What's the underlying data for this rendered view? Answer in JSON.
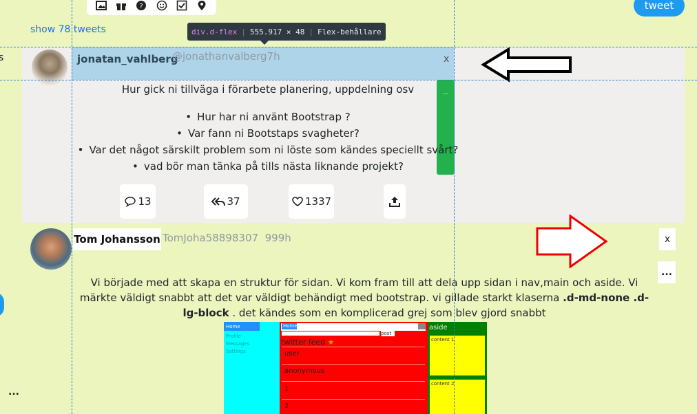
{
  "toolbar": {
    "icons": [
      "image-icon",
      "gift-icon",
      "question-icon",
      "smiley-icon",
      "checkbox-icon",
      "location-pin-icon"
    ],
    "tweet_button": "tweet"
  },
  "feed": {
    "show_tweets_link": "show 78 tweets"
  },
  "devtools_tooltip": {
    "selector": "div.d-flex",
    "size": "555.917 × 48",
    "label": "Flex-behållare"
  },
  "tweet1": {
    "username": "jonatan_vahlberg",
    "handle": "@jonathanvalberg7h",
    "close": "x",
    "handle_dots": "...",
    "heading": "Hur gick ni tillväga i förarbete planering, uppdelning osv",
    "bullets": [
      "Hur har ni använt Bootstrap ?",
      "Var fann ni Bootstaps svagheter?",
      "Var det något särskilt problem som ni löste som kändes speciellt svårt?",
      "vad bör man tänka på tills nästa liknande projekt?"
    ],
    "actions": {
      "comments": "13",
      "retweets": "37",
      "likes": "1337"
    }
  },
  "tweet2": {
    "username": "Tom Johansson",
    "handle": "TomJoha58898307",
    "age": "999h",
    "close": "x",
    "more": "...",
    "text_start": "Vi började med att skapa en struktur för sidan. Vi kom fram till att dela upp sidan i nav,main och aside. Vi märkte väldigt snabbt att det var väldigt behändigt med bootstrap. vi gillade starkt klaserna ",
    "text_bold": ".d-md-none .d-lg-block",
    "text_end": " . det kändes som en komplicerad grej som blev gjord snabbt",
    "embed": {
      "nav_items": [
        "Profile",
        "Messages",
        "Settings"
      ],
      "nav_link": "Home",
      "tab": "Home",
      "post_button": "post",
      "feed_title": "twitter feed",
      "entries": [
        "user",
        "anonymous",
        "1",
        "2"
      ],
      "aside_title": "aside",
      "content_1": "content 1",
      "content_2": "content 2"
    }
  },
  "edge": {
    "left_text": "s",
    "dots": "..."
  },
  "colors": {
    "background": "#ebf5bd",
    "accent": "#1d9bf0",
    "highlight": "#b4dcee",
    "green": "#22b14c"
  }
}
